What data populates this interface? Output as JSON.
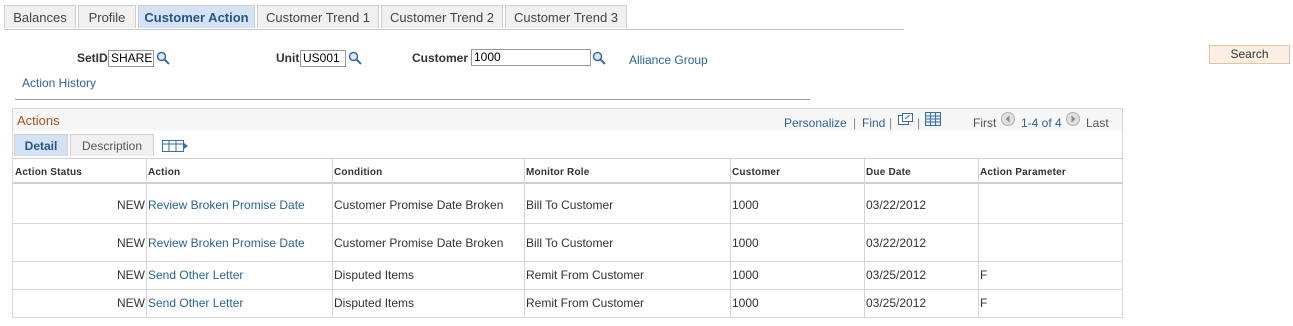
{
  "tabs": [
    {
      "label": "Balances"
    },
    {
      "label": "Profile"
    },
    {
      "label": "Customer Action"
    },
    {
      "label": "Customer Trend 1"
    },
    {
      "label": "Customer Trend 2"
    },
    {
      "label": "Customer Trend 3"
    }
  ],
  "filters": {
    "setid_label": "SetID",
    "setid_value": "SHARE",
    "unit_label": "Unit",
    "unit_value": "US001",
    "customer_label": "Customer",
    "customer_value": "1000",
    "alliance_link": "Alliance Group",
    "search_label": "Search",
    "action_history_link": "Action History"
  },
  "grid": {
    "title": "Actions",
    "personalize": "Personalize",
    "find": "Find",
    "first": "First",
    "range": "1-4 of 4",
    "last": "Last",
    "subtabs": [
      {
        "label": "Detail"
      },
      {
        "label": "Description"
      }
    ],
    "columns": [
      "Action Status",
      "Action",
      "Condition",
      "Monitor Role",
      "Customer",
      "Due Date",
      "Action Parameter"
    ],
    "rows": [
      {
        "status": "NEW",
        "action": "Review Broken Promise Date",
        "condition": "Customer Promise Date Broken",
        "role": "Bill To Customer",
        "customer": "1000",
        "due": "03/22/2012",
        "param": ""
      },
      {
        "status": "NEW",
        "action": "Review Broken Promise Date",
        "condition": "Customer Promise Date Broken",
        "role": "Bill To Customer",
        "customer": "1000",
        "due": "03/22/2012",
        "param": ""
      },
      {
        "status": "NEW",
        "action": "Send Other Letter",
        "condition": "Disputed Items",
        "role": "Remit From Customer",
        "customer": "1000",
        "due": "03/25/2012",
        "param": "F"
      },
      {
        "status": "NEW",
        "action": "Send Other Letter",
        "condition": "Disputed Items",
        "role": "Remit From Customer",
        "customer": "1000",
        "due": "03/25/2012",
        "param": "F"
      }
    ]
  },
  "icons": {
    "lookup": "magnifier-icon",
    "zoom": "view-all-icon",
    "download": "download-grid-icon",
    "prev": "previous-arrow-icon",
    "next": "next-arrow-icon",
    "show_all_columns": "show-all-columns-icon"
  }
}
